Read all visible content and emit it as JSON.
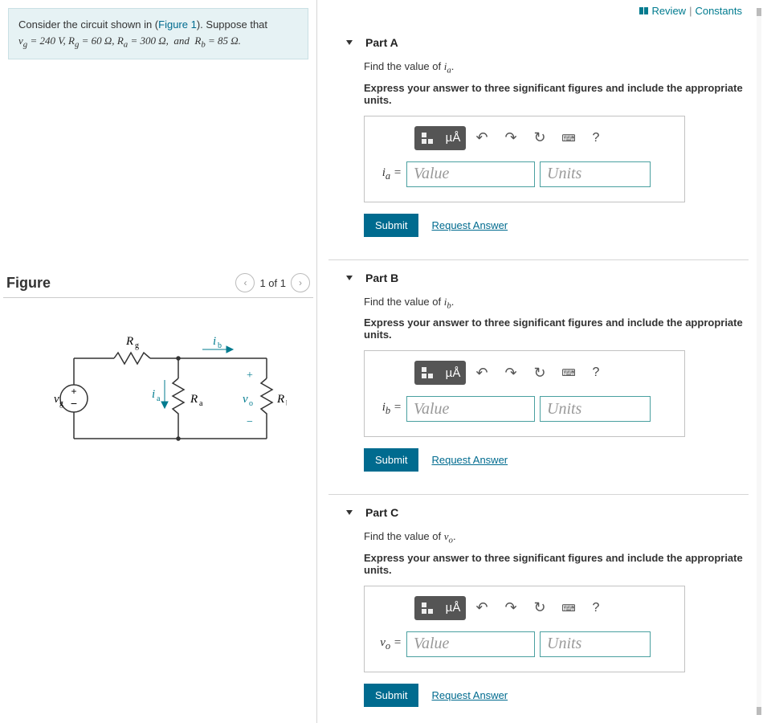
{
  "topbar": {
    "review_label": "Review",
    "constants_label": "Constants"
  },
  "problem": {
    "intro_pre": "Consider the circuit shown in (",
    "figure_link": "Figure 1",
    "intro_post": "). Suppose that",
    "values_html": "v_g = 240 V, R_g = 60 Ω, R_a = 300 Ω,  and  R_b = 85 Ω."
  },
  "figure": {
    "title": "Figure",
    "counter": "1 of 1",
    "labels": {
      "vg": "v_g",
      "Rg": "R_g",
      "Ra": "R_a",
      "Rb": "R_b",
      "ia": "i_a",
      "ib": "i_b",
      "vo": "v_o"
    }
  },
  "shared": {
    "instructions": "Express your answer to three significant figures and include the appropriate units.",
    "value_placeholder": "Value",
    "units_placeholder": "Units",
    "submit_label": "Submit",
    "request_label": "Request Answer",
    "toolbar": {
      "template_icon": "templates",
      "greek_label": "µÅ",
      "undo": "↶",
      "redo": "↷",
      "reset": "↻",
      "keyboard": "⌨",
      "help": "?"
    }
  },
  "parts": [
    {
      "id": "A",
      "title": "Part A",
      "prompt_pre": "Find the value of ",
      "var": "i_a",
      "prompt_post": "."
    },
    {
      "id": "B",
      "title": "Part B",
      "prompt_pre": "Find the value of ",
      "var": "i_b",
      "prompt_post": "."
    },
    {
      "id": "C",
      "title": "Part C",
      "prompt_pre": "Find the value of ",
      "var": "v_o",
      "prompt_post": "."
    }
  ]
}
